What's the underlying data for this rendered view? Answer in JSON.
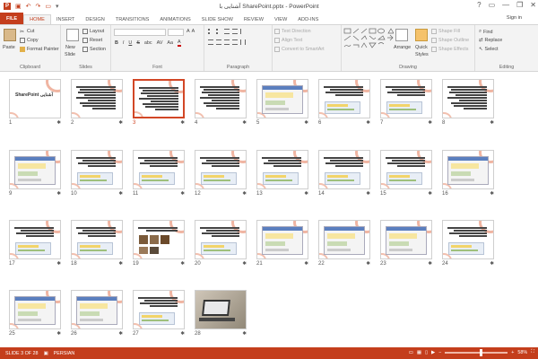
{
  "window": {
    "title": "آشنایی با SharePoint.pptx - PowerPoint",
    "sign_in": "Sign in",
    "controls": [
      "?",
      "—",
      "❐",
      "✕"
    ]
  },
  "quick_access": [
    "save-icon",
    "undo-icon",
    "redo-icon",
    "slideshow-start-icon"
  ],
  "tabs": [
    "FILE",
    "HOME",
    "INSERT",
    "DESIGN",
    "TRANSITIONS",
    "ANIMATIONS",
    "SLIDE SHOW",
    "REVIEW",
    "VIEW",
    "ADD-INS"
  ],
  "active_tab": "HOME",
  "ribbon": {
    "clipboard": {
      "paste": "Paste",
      "cut": "Cut",
      "copy": "Copy",
      "format_painter": "Format Painter",
      "label": "Clipboard"
    },
    "slides": {
      "new_slide": "New",
      "new_slide2": "Slide",
      "layout": "Layout",
      "reset": "Reset",
      "section": "Section",
      "label": "Slides"
    },
    "font": {
      "bold": "B",
      "italic": "I",
      "underline": "U",
      "strike": "S",
      "shadow": "abc",
      "spacing": "AV",
      "case": "Aa",
      "font_color": "A",
      "label": "Font"
    },
    "paragraph": {
      "text_direction": "Text Direction",
      "align_text": "Align Text",
      "smartart": "Convert to SmartArt",
      "label": "Paragraph"
    },
    "drawing": {
      "arrange": "Arrange",
      "quick_styles": "Quick",
      "quick_styles2": "Styles",
      "shape_fill": "Shape Fill",
      "shape_outline": "Shape Outline",
      "shape_effects": "Shape Effects",
      "label": "Drawing"
    },
    "editing": {
      "find": "Find",
      "replace": "Replace",
      "select": "Select",
      "label": "Editing"
    }
  },
  "slides": [
    {
      "n": "1",
      "kind": "title",
      "text": "SharePoint آشنایی"
    },
    {
      "n": "2",
      "kind": "text"
    },
    {
      "n": "3",
      "kind": "text",
      "selected": true
    },
    {
      "n": "4",
      "kind": "text"
    },
    {
      "n": "5",
      "kind": "screenshot"
    },
    {
      "n": "6",
      "kind": "text-shot"
    },
    {
      "n": "7",
      "kind": "text-shot"
    },
    {
      "n": "8",
      "kind": "text"
    },
    {
      "n": "9",
      "kind": "screenshot"
    },
    {
      "n": "10",
      "kind": "text-shot"
    },
    {
      "n": "11",
      "kind": "text-shot"
    },
    {
      "n": "12",
      "kind": "text-shot"
    },
    {
      "n": "13",
      "kind": "text-shot"
    },
    {
      "n": "14",
      "kind": "text-shot"
    },
    {
      "n": "15",
      "kind": "text-shot"
    },
    {
      "n": "16",
      "kind": "screenshot"
    },
    {
      "n": "17",
      "kind": "text-shot"
    },
    {
      "n": "18",
      "kind": "text-shot"
    },
    {
      "n": "19",
      "kind": "images"
    },
    {
      "n": "20",
      "kind": "text-shot"
    },
    {
      "n": "21",
      "kind": "screenshot"
    },
    {
      "n": "22",
      "kind": "screenshot"
    },
    {
      "n": "23",
      "kind": "screenshot"
    },
    {
      "n": "24",
      "kind": "text-shot"
    },
    {
      "n": "25",
      "kind": "screenshot"
    },
    {
      "n": "26",
      "kind": "screenshot"
    },
    {
      "n": "27",
      "kind": "text-shot"
    },
    {
      "n": "28",
      "kind": "photo"
    }
  ],
  "status": {
    "slide": "SLIDE 3 OF 28",
    "language": "PERSIAN",
    "zoom": "58%",
    "zoom_level": 0.58
  },
  "colors": {
    "accent": "#c43e1c",
    "selected": "#d24726"
  }
}
